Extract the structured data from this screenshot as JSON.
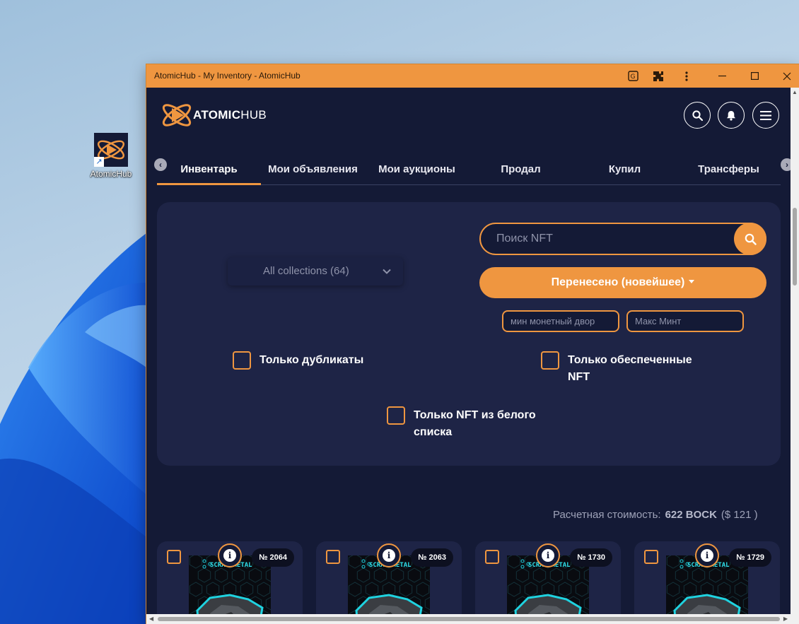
{
  "desktop": {
    "icon_label": "AtomicHub"
  },
  "window": {
    "title": "AtomicHub - My Inventory - AtomicHub"
  },
  "header": {
    "logo_bold": "ATOMIC",
    "logo_light": "HUB"
  },
  "tabs": [
    {
      "label": "Инвентарь",
      "active": true
    },
    {
      "label": "Мои объявления",
      "active": false
    },
    {
      "label": "Мои аукционы",
      "active": false
    },
    {
      "label": "Продал",
      "active": false
    },
    {
      "label": "Купил",
      "active": false
    },
    {
      "label": "Трансферы",
      "active": false
    }
  ],
  "filters": {
    "collection": "All collections (64)",
    "search_placeholder": "Поиск NFT",
    "sort_label": "Перенесено (новейшее)",
    "min_mint_placeholder": "мин монетный двор",
    "max_mint_placeholder": "Макс Минт",
    "duplicates_label": "Только дубликаты",
    "backed_label": "Только обеспеченные NFT",
    "whitelist_label": "Только NFT из белого списка"
  },
  "estimate": {
    "label": "Расчетная стоимость:",
    "value": "622 BOCK",
    "usd": "($ 121 )"
  },
  "cards": [
    {
      "number": "№ 2064",
      "title": "SCRAP METAL"
    },
    {
      "number": "№ 2063",
      "title": "SCRAP METAL"
    },
    {
      "number": "№ 1730",
      "title": "SCRAP METAL"
    },
    {
      "number": "№ 1729",
      "title": "SCRAP METAL"
    }
  ],
  "colors": {
    "accent": "#ef9640",
    "bg": "#141a36",
    "panel": "#1e2446"
  }
}
